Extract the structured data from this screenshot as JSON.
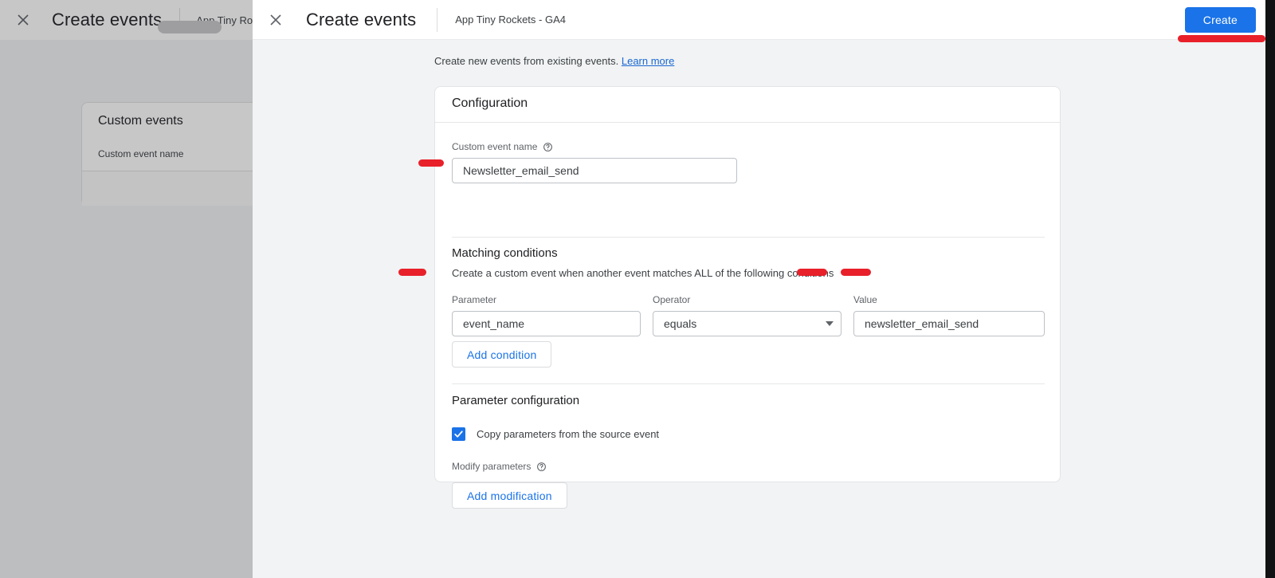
{
  "background_page": {
    "close_icon": "close-icon",
    "title": "Create events",
    "property": "App Tiny Rockets - G",
    "card": {
      "title": "Custom events",
      "column_header": "Custom event name"
    }
  },
  "modal": {
    "close_icon": "close-icon",
    "title": "Create events",
    "property": "App Tiny Rockets - GA4",
    "create_button": "Create",
    "intro": {
      "text": "Create new events from existing events.",
      "link": "Learn more"
    },
    "configuration": {
      "card_title": "Configuration",
      "custom_event_name": {
        "label": "Custom event name",
        "help_icon": "help-icon",
        "value": "Newsletter_email_send",
        "placeholder": ""
      },
      "matching_conditions": {
        "title": "Matching conditions",
        "description": "Create a custom event when another event matches ALL of the following conditions",
        "columns": {
          "parameter": "Parameter",
          "operator": "Operator",
          "value": "Value"
        },
        "rows": [
          {
            "parameter": "event_name",
            "operator": "equals",
            "value": "newsletter_email_send"
          }
        ],
        "add_condition_button": "Add condition"
      },
      "parameter_configuration": {
        "title": "Parameter configuration",
        "copy_parameters_label": "Copy parameters from the source event",
        "copy_parameters_checked": true,
        "modify_parameters_label": "Modify parameters",
        "modify_parameters_help_icon": "help-icon",
        "add_modification_button": "Add modification"
      }
    }
  },
  "annotations": {
    "color": "#e8202a",
    "marks": [
      "create-button-underline",
      "custom-event-name-dash",
      "parameter-dash",
      "operator-dash",
      "value-dash"
    ]
  },
  "colors": {
    "accent_blue": "#1a73e8",
    "link_blue": "#1967d2",
    "page_background": "#f1f3f4",
    "card_background": "#ffffff",
    "annotation_red": "#e8202a"
  }
}
